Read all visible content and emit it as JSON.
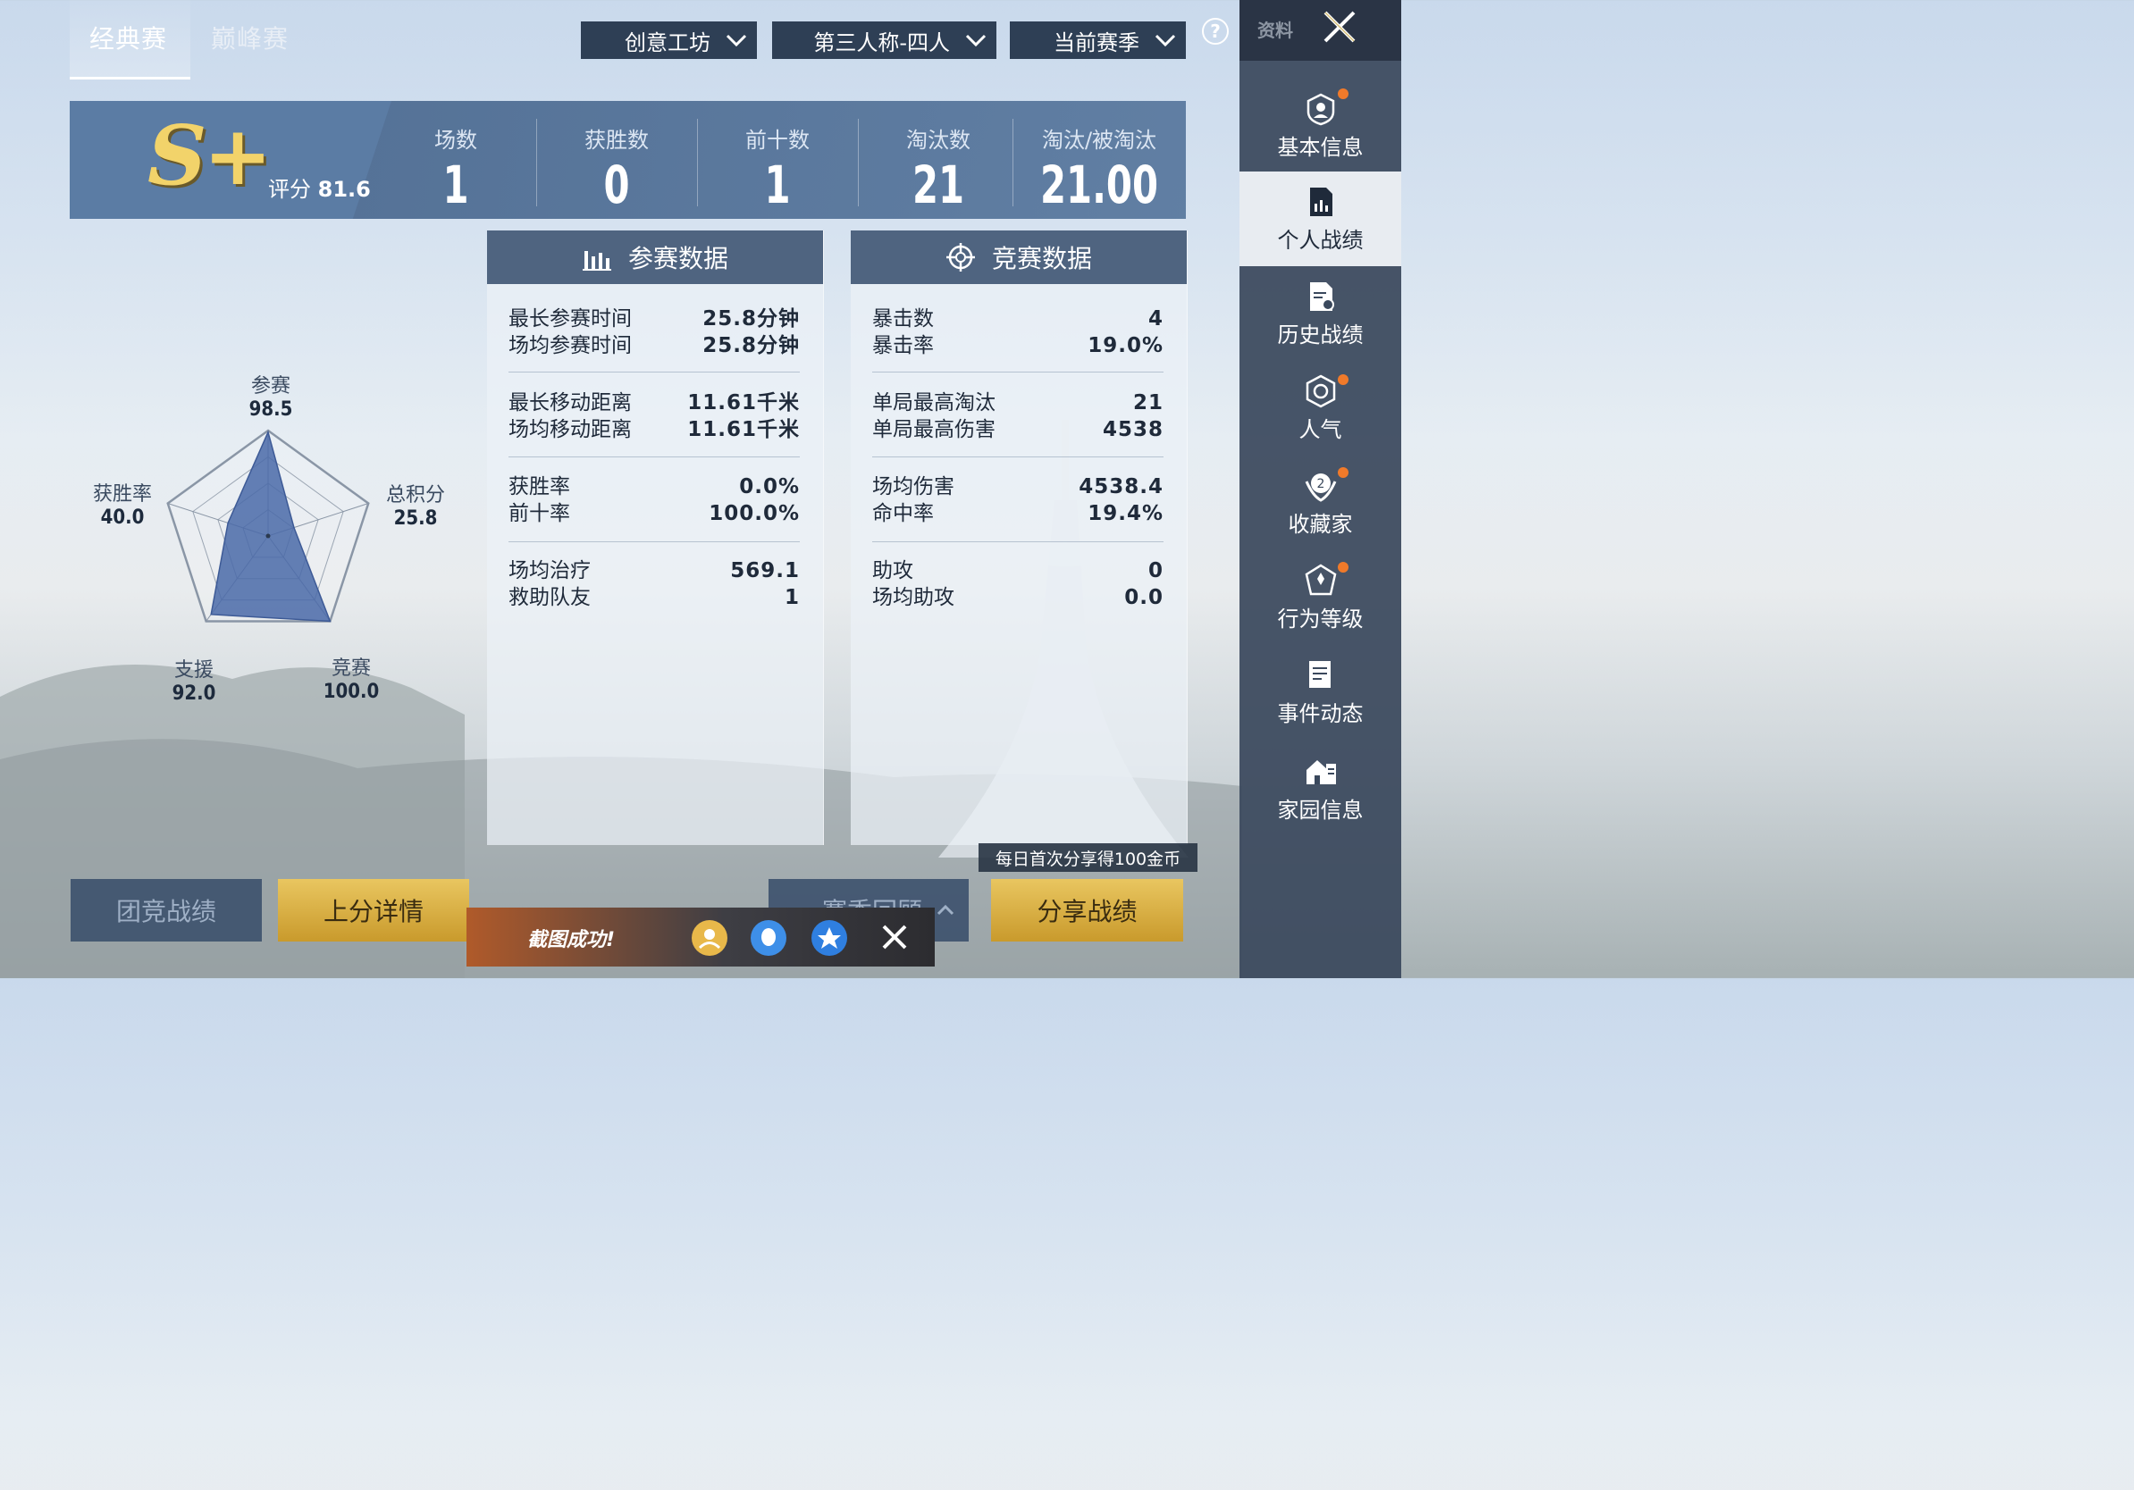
{
  "tabs": [
    "经典赛",
    "巅峰赛"
  ],
  "dropdowns": [
    "创意工坊",
    "第三人称-四人",
    "当前赛季"
  ],
  "help": "?",
  "sidebar": {
    "title": "资料",
    "items": [
      "基本信息",
      "个人战绩",
      "历史战绩",
      "人气",
      "收藏家",
      "行为等级",
      "事件动态",
      "家园信息"
    ],
    "collector_badge": "2"
  },
  "rank": {
    "grade": "S+",
    "score_label": "评分",
    "score": "81.6"
  },
  "stats": [
    {
      "label": "场数",
      "value": "1"
    },
    {
      "label": "获胜数",
      "value": "0"
    },
    {
      "label": "前十数",
      "value": "1"
    },
    {
      "label": "淘汰数",
      "value": "21"
    },
    {
      "label": "淘汰/被淘汰",
      "value": "21.00"
    }
  ],
  "radar": {
    "axes": [
      {
        "label": "参赛",
        "value": "98.5",
        "score": 98.5
      },
      {
        "label": "总积分",
        "value": "25.8",
        "score": 25.8
      },
      {
        "label": "竞赛",
        "value": "100.0",
        "score": 100.0
      },
      {
        "label": "支援",
        "value": "92.0",
        "score": 92.0
      },
      {
        "label": "获胜率",
        "value": "40.0",
        "score": 40.0
      }
    ]
  },
  "participation": {
    "title": "参赛数据",
    "groups": [
      [
        {
          "k": "最长参赛时间",
          "v": "25.8分钟"
        },
        {
          "k": "场均参赛时间",
          "v": "25.8分钟"
        }
      ],
      [
        {
          "k": "最长移动距离",
          "v": "11.61千米"
        },
        {
          "k": "场均移动距离",
          "v": "11.61千米"
        }
      ],
      [
        {
          "k": "获胜率",
          "v": "0.0%"
        },
        {
          "k": "前十率",
          "v": "100.0%"
        }
      ],
      [
        {
          "k": "场均治疗",
          "v": "569.1"
        },
        {
          "k": "救助队友",
          "v": "1"
        }
      ]
    ]
  },
  "combat": {
    "title": "竞赛数据",
    "groups": [
      [
        {
          "k": "暴击数",
          "v": "4"
        },
        {
          "k": "暴击率",
          "v": "19.0%"
        }
      ],
      [
        {
          "k": "单局最高淘汰",
          "v": "21"
        },
        {
          "k": "单局最高伤害",
          "v": "4538"
        }
      ],
      [
        {
          "k": "场均伤害",
          "v": "4538.4"
        },
        {
          "k": "命中率",
          "v": "19.4%"
        }
      ],
      [
        {
          "k": "助攻",
          "v": "0"
        },
        {
          "k": "场均助攻",
          "v": "0.0"
        }
      ]
    ]
  },
  "bottom": {
    "team_button": "团竞战绩",
    "rank_button": "上分详情",
    "season_button": "赛季回顾",
    "share_button": "分享战绩",
    "share_tip": "每日首次分享得100金币"
  },
  "toast": {
    "text": "截图成功!"
  },
  "colors": {
    "accent_gold": "#e9c660",
    "panel_head": "#4f6480",
    "sidebar": "#3a485c",
    "notify_dot": "#f07a2a",
    "radar_fill": "#4a6aa8"
  }
}
